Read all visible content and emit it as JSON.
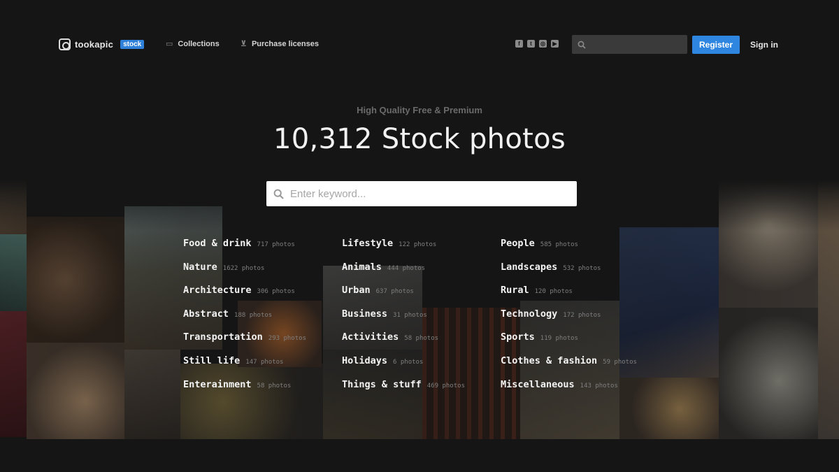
{
  "brand": {
    "name": "tookapic",
    "badge": "stock"
  },
  "nav": [
    {
      "label": "Collections",
      "icon": "folder-icon"
    },
    {
      "label": "Purchase licenses",
      "icon": "cart-icon"
    }
  ],
  "social": [
    {
      "name": "facebook-icon",
      "glyph": "f"
    },
    {
      "name": "twitter-icon",
      "glyph": "t"
    },
    {
      "name": "instagram-icon",
      "glyph": "◎"
    },
    {
      "name": "youtube-icon",
      "glyph": "▶"
    }
  ],
  "header_search": {
    "placeholder": "",
    "icon": "search-icon"
  },
  "auth": {
    "register": "Register",
    "signin": "Sign in"
  },
  "hero": {
    "tagline": "High Quality Free & Premium",
    "title": "10,312 Stock photos",
    "search_placeholder": "Enter keyword..."
  },
  "categories": [
    [
      {
        "name": "Food & drink",
        "count": "717 photos"
      },
      {
        "name": "Nature",
        "count": "1622 photos"
      },
      {
        "name": "Architecture",
        "count": "306 photos"
      },
      {
        "name": "Abstract",
        "count": "188 photos"
      },
      {
        "name": "Transportation",
        "count": "293 photos"
      },
      {
        "name": "Still life",
        "count": "147 photos"
      },
      {
        "name": "Enterainment",
        "count": "58 photos"
      }
    ],
    [
      {
        "name": "Lifestyle",
        "count": "122 photos"
      },
      {
        "name": "Animals",
        "count": "444 photos"
      },
      {
        "name": "Urban",
        "count": "637 photos"
      },
      {
        "name": "Business",
        "count": "31 photos"
      },
      {
        "name": "Activities",
        "count": "58 photos"
      },
      {
        "name": "Holidays",
        "count": "6 photos"
      },
      {
        "name": "Things & stuff",
        "count": "469 photos"
      }
    ],
    [
      {
        "name": "People",
        "count": "585 photos"
      },
      {
        "name": "Landscapes",
        "count": "532 photos"
      },
      {
        "name": "Rural",
        "count": "120 photos"
      },
      {
        "name": "Technology",
        "count": "172 photos"
      },
      {
        "name": "Sports",
        "count": "119 photos"
      },
      {
        "name": "Clothes & fashion",
        "count": "59 photos"
      },
      {
        "name": "Miscellaneous",
        "count": "143 photos"
      }
    ]
  ],
  "colors": {
    "accent": "#2f86e0",
    "background": "#151515",
    "badge": "#2f80d8"
  }
}
